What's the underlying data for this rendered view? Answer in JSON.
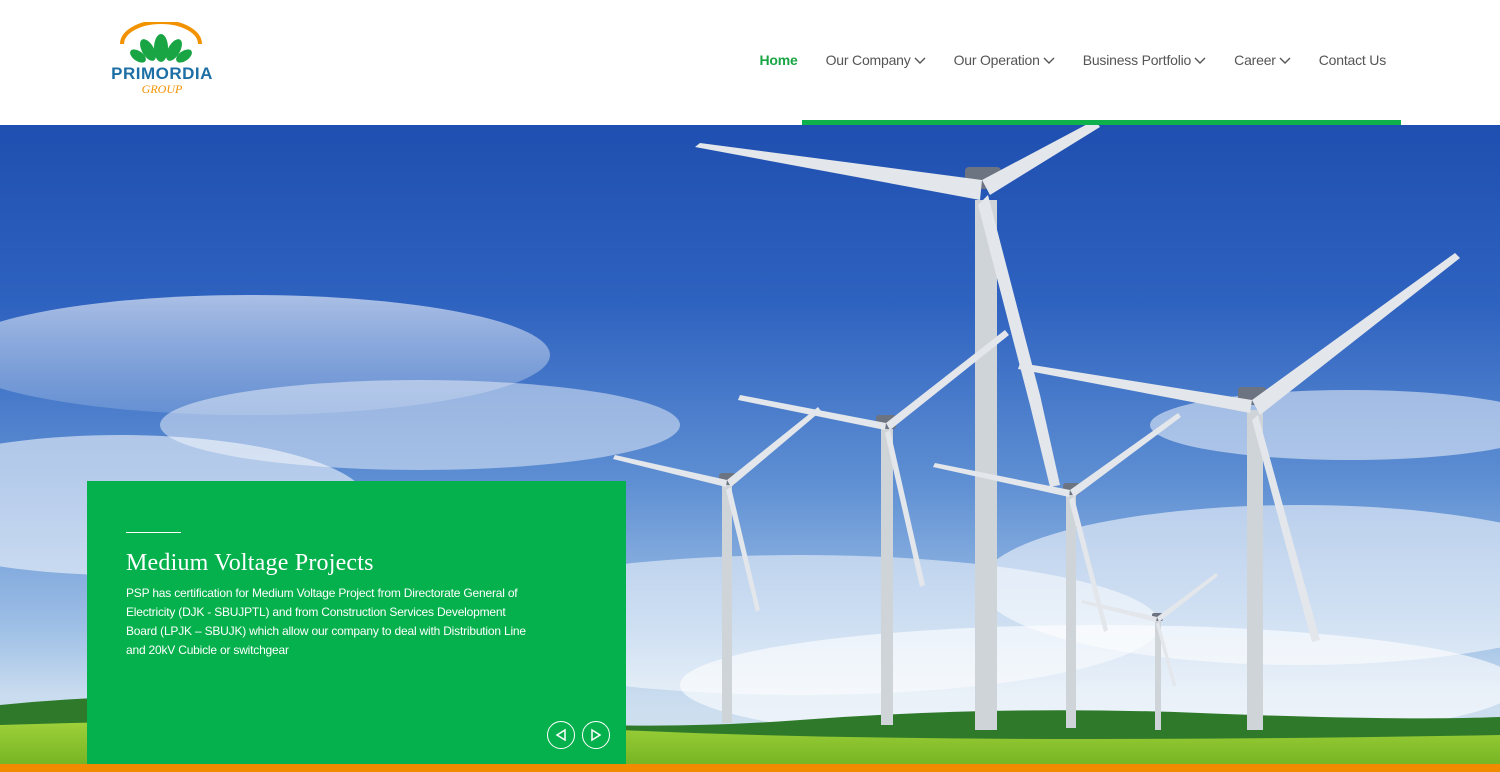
{
  "brand": {
    "name": "PRIMORDIA",
    "sub": "GROUP",
    "accent": "#0fb14c",
    "orange": "#f28a00",
    "blue": "#1d6fa5"
  },
  "nav": {
    "items": [
      {
        "label": "Home",
        "active": true
      },
      {
        "label": "Our Company",
        "dropdown": true
      },
      {
        "label": "Our Operation",
        "dropdown": true
      },
      {
        "label": "Business Portfolio",
        "dropdown": true
      },
      {
        "label": "Career",
        "dropdown": true
      },
      {
        "label": "Contact Us"
      }
    ]
  },
  "slide": {
    "title": "Medium Voltage Projects",
    "text": "PSP has certification for Medium Voltage Project from Directorate General of Electricity (DJK - SBUJPTL) and from Construction Services Development Board (LPJK – SBUJK) which allow our company to deal with Distribution Line and 20kV Cubicle or switchgear",
    "prev_icon": "triangle-left-icon",
    "next_icon": "triangle-right-icon"
  }
}
